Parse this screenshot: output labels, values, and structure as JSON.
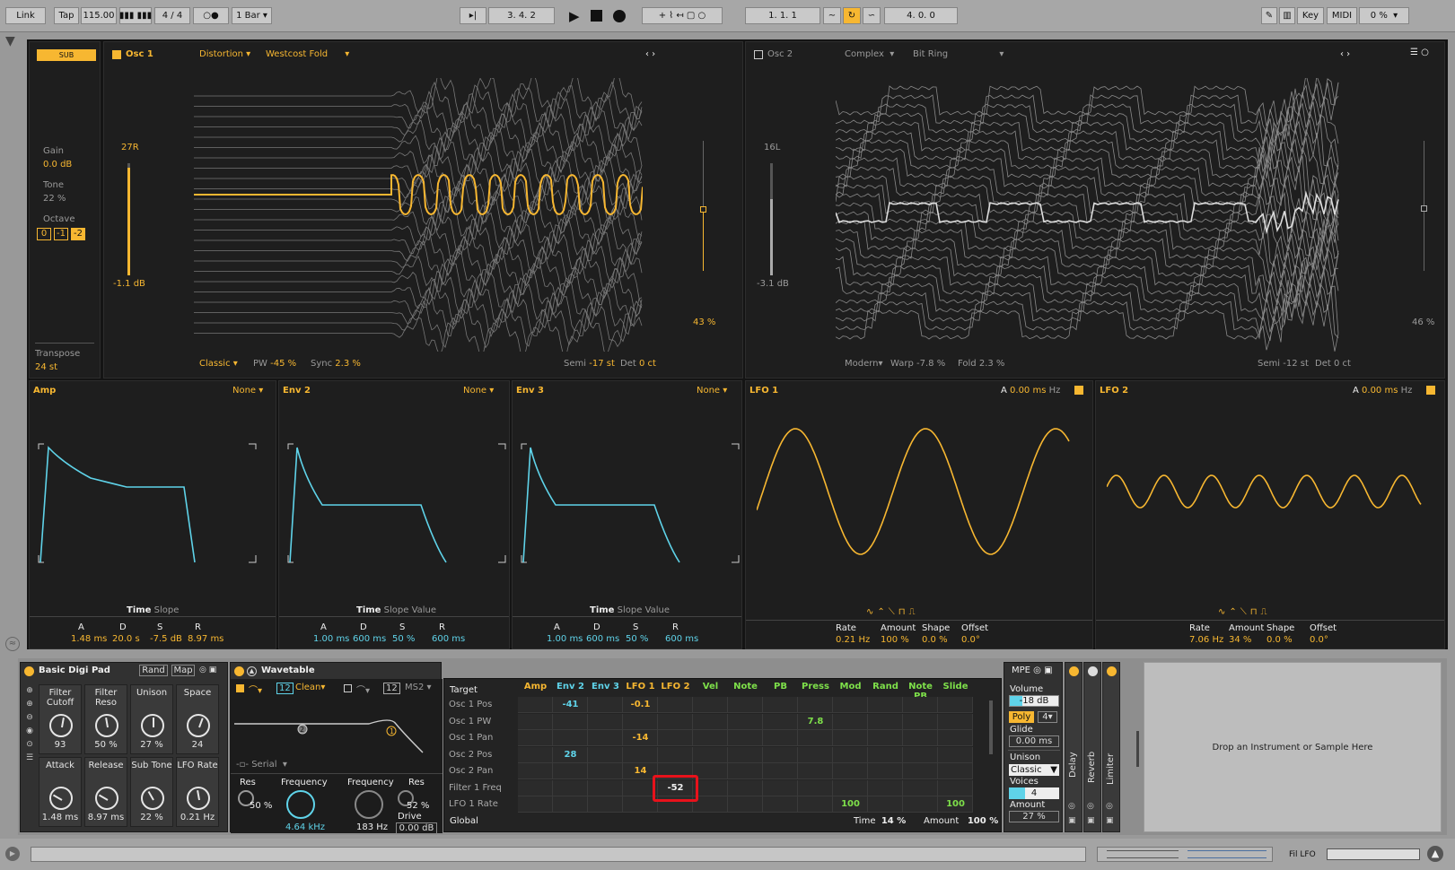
{
  "transport": {
    "link": "Link",
    "tap": "Tap",
    "tempo": "115.00",
    "sig": "4 / 4",
    "rec_mode": "○●",
    "quant": "1 Bar",
    "arr_pos": "3.   4.   2",
    "loop_start": "1.   1.   1",
    "loop_len": "4.   0.   0",
    "key": "Key",
    "midi": "MIDI",
    "cpu": "0 %"
  },
  "osc_section": {
    "sub_badge": "SUB",
    "gain_label": "Gain",
    "gain_value": "0.0 dB",
    "tone_label": "Tone",
    "tone_value": "22 %",
    "octave_label": "Octave",
    "octaves": [
      "0",
      "-1",
      "-2"
    ],
    "transpose_label": "Transpose",
    "transpose_value": "24 st"
  },
  "osc1": {
    "title": "Osc 1",
    "category": "Distortion",
    "wavetable": "Westcost Fold",
    "pan": "27R",
    "level": "-1.1 dB",
    "mode": "Classic",
    "pw_label": "PW",
    "pw_value": "-45 %",
    "sync_label": "Sync",
    "sync_value": "2.3 %",
    "semi_label": "Semi",
    "semi_value": "-17 st",
    "det_label": "Det",
    "det_value": "0 ct",
    "pos": "43 %"
  },
  "osc2": {
    "title": "Osc 2",
    "category": "Complex",
    "wavetable": "Bit Ring",
    "pan": "16L",
    "level": "-3.1 dB",
    "mode": "Modern",
    "warp_label": "Warp",
    "warp_value": "-7.8 %",
    "fold_label": "Fold",
    "fold_value": "2.3 %",
    "semi_label": "Semi",
    "semi_value": "-12 st",
    "det_label": "Det",
    "det_value": "0 ct",
    "pos": "46 %"
  },
  "envs": [
    {
      "title": "Amp",
      "target": "None",
      "tabs": [
        "Time",
        "Slope"
      ],
      "labels": [
        "A",
        "D",
        "S",
        "R"
      ],
      "values": [
        "1.48 ms",
        "20.0 s",
        "-7.5 dB",
        "8.97 ms"
      ]
    },
    {
      "title": "Env 2",
      "target": "None",
      "tabs": [
        "Time",
        "Slope",
        "Value"
      ],
      "labels": [
        "A",
        "D",
        "S",
        "R"
      ],
      "values": [
        "1.00 ms",
        "600 ms",
        "50 %",
        "600 ms"
      ]
    },
    {
      "title": "Env 3",
      "target": "None",
      "tabs": [
        "Time",
        "Slope",
        "Value"
      ],
      "labels": [
        "A",
        "D",
        "S",
        "R"
      ],
      "values": [
        "1.00 ms",
        "600 ms",
        "50 %",
        "600 ms"
      ]
    }
  ],
  "lfos": [
    {
      "title": "LFO 1",
      "a_label": "A",
      "a_value": "0.00 ms",
      "unit": "Hz",
      "labels": [
        "Rate",
        "Amount",
        "Shape",
        "Offset"
      ],
      "values": [
        "0.21 Hz",
        "100 %",
        "0.0 %",
        "0.0°"
      ]
    },
    {
      "title": "LFO 2",
      "a_label": "A",
      "a_value": "0.00 ms",
      "unit": "Hz",
      "labels": [
        "Rate",
        "Amount",
        "Shape",
        "Offset"
      ],
      "values": [
        "7.06 Hz",
        "34 %",
        "0.0 %",
        "0.0°"
      ]
    }
  ],
  "rack": {
    "title": "Basic Digi Pad",
    "rand": "Rand",
    "map": "Map",
    "macros": [
      {
        "label": "Filter Cutoff",
        "value": "93"
      },
      {
        "label": "Filter Reso",
        "value": "50 %"
      },
      {
        "label": "Unison",
        "value": "27 %"
      },
      {
        "label": "Space",
        "value": "24"
      },
      {
        "label": "Attack",
        "value": "1.48 ms"
      },
      {
        "label": "Release",
        "value": "8.97 ms"
      },
      {
        "label": "Sub Tone",
        "value": "22 %"
      },
      {
        "label": "LFO Rate",
        "value": "0.21 Hz"
      }
    ]
  },
  "wavetable": {
    "title": "Wavetable",
    "filter1_num": "12",
    "filter1_type": "Clean",
    "filter2_num": "12",
    "filter2_type": "MS2",
    "routing": "Serial",
    "res_label": "Res",
    "res_value": "50 %",
    "freq_label": "Frequency",
    "freq_value": "4.64 kHz",
    "freq2_label": "Frequency",
    "freq2_value": "183 Hz",
    "res2_label": "Res",
    "res2_value": "52 %",
    "drive_label": "Drive",
    "drive_value": "0.00 dB"
  },
  "matrix": {
    "target_label": "Target",
    "columns": [
      "Amp",
      "Env 2",
      "Env 3",
      "LFO 1",
      "LFO 2",
      "Vel",
      "Note",
      "PB",
      "Press",
      "Mod",
      "Rand",
      "Note PB",
      "Slide"
    ],
    "rows": [
      "Osc 1 Pos",
      "Osc 1 PW",
      "Osc 1 Pan",
      "Osc 2 Pos",
      "Osc 2 Pan",
      "Filter 1 Freq",
      "LFO 1 Rate"
    ],
    "values": [
      {
        "r": 0,
        "c": 1,
        "v": "-41",
        "col": "cy"
      },
      {
        "r": 0,
        "c": 3,
        "v": "-0.1",
        "col": "or"
      },
      {
        "r": 1,
        "c": 8,
        "v": "7.8",
        "col": "gn"
      },
      {
        "r": 2,
        "c": 3,
        "v": "-14",
        "col": "or"
      },
      {
        "r": 3,
        "c": 1,
        "v": "28",
        "col": "cy"
      },
      {
        "r": 4,
        "c": 3,
        "v": "14",
        "col": "or"
      },
      {
        "r": 5,
        "c": 4,
        "v": "-52",
        "col": "wh"
      },
      {
        "r": 6,
        "c": 9,
        "v": "100",
        "col": "gn"
      },
      {
        "r": 6,
        "c": 12,
        "v": "100",
        "col": "gn"
      }
    ],
    "global_label": "Global",
    "time_label": "Time",
    "time_value": "14 %",
    "amount_label": "Amount",
    "amount_value": "100 %"
  },
  "voice": {
    "mpe": "MPE",
    "volume_label": "Volume",
    "volume_value": "-18 dB",
    "poly": "Poly",
    "poly_voices": "4",
    "glide_label": "Glide",
    "glide_value": "0.00 ms",
    "unison_label": "Unison",
    "unison_mode": "Classic",
    "voices_label": "Voices",
    "voices_value": "4",
    "amount_label": "Amount",
    "amount_value": "27 %"
  },
  "fx": [
    "Delay",
    "Reverb",
    "Limiter"
  ],
  "drop_text": "Drop an Instrument or Sample Here",
  "status": {
    "clip": "Fil LFO"
  },
  "colors": {
    "accent": "#f7b731",
    "cyan": "#5fd3e9",
    "panel": "#1e1e1e"
  }
}
